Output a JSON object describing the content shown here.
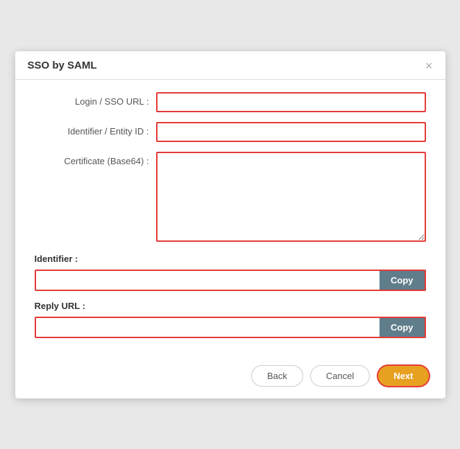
{
  "dialog": {
    "title": "SSO by SAML",
    "close_label": "×"
  },
  "form": {
    "login_sso_url_label": "Login / SSO URL :",
    "login_sso_url_value": "",
    "login_sso_url_placeholder": "",
    "identifier_entity_id_label": "Identifier / Entity ID :",
    "identifier_entity_id_value": "",
    "identifier_entity_id_placeholder": "",
    "certificate_label": "Certificate (Base64) :",
    "certificate_value": "",
    "certificate_placeholder": ""
  },
  "identifier_section": {
    "label": "Identifier :",
    "value": "",
    "copy_button": "Copy"
  },
  "reply_url_section": {
    "label": "Reply URL :",
    "value": "",
    "copy_button": "Copy"
  },
  "footer": {
    "back_label": "Back",
    "cancel_label": "Cancel",
    "next_label": "Next"
  }
}
